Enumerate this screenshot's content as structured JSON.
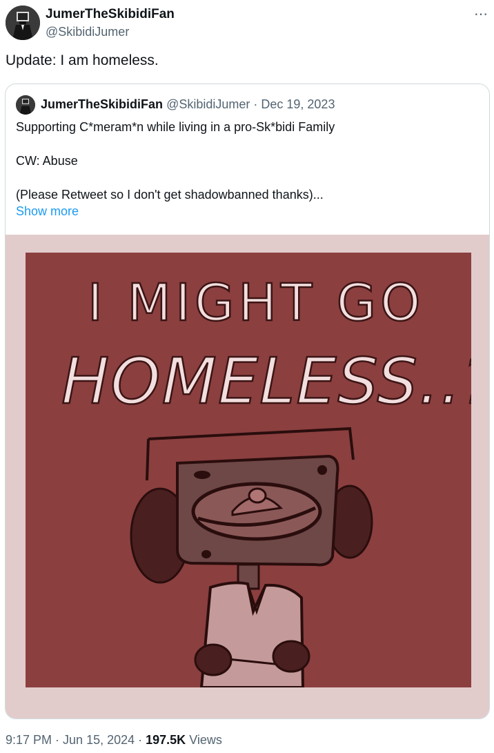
{
  "author": {
    "name": "JumerTheSkibidiFan",
    "handle": "@SkibidiJumer"
  },
  "more_icon": "⋯",
  "tweet_text": "Update: I am homeless.",
  "quoted": {
    "name": "JumerTheSkibidiFan",
    "handle": "@SkibidiJumer",
    "separator": " · ",
    "date": "Dec 19, 2023",
    "lines": [
      "Supporting C*meram*n while living in a pro-Sk*bidi Family",
      "CW: Abuse",
      "(Please Retweet so I don't get shadowbanned thanks)..."
    ],
    "show_more": "Show more",
    "image_text_line1": "I MIGHT GO",
    "image_text_line2": "HOMELESS..?"
  },
  "footer": {
    "time": "9:17 PM",
    "sep1": " · ",
    "date": "Jun 15, 2024",
    "sep2": " · ",
    "views_count": "197.5K",
    "views_label": " Views"
  },
  "colors": {
    "art_bg": "#8b3f3f",
    "media_bg": "#e2cccb",
    "link": "#1d9bf0"
  }
}
